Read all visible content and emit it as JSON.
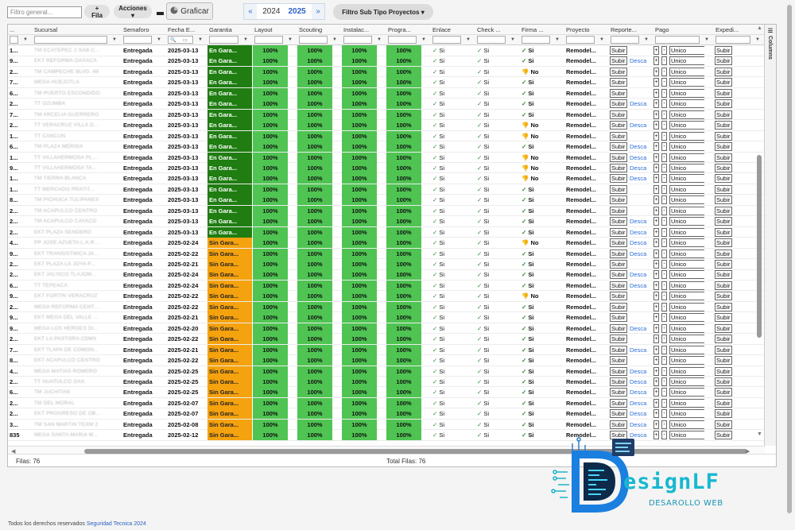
{
  "toolbar": {
    "filter_placeholder": "Filtro general...",
    "add_row_label": "+ Fila",
    "actions_label": "Acciones ▾",
    "chart_label": "Graficar",
    "years": [
      "2024",
      "2025"
    ],
    "active_year": "2025",
    "prev_label": "«",
    "next_label": "»",
    "subtype_label": "Filtro Sub Tipo Proyectos ▾"
  },
  "colors": {
    "garantia_en": "#1f7d12",
    "garantia_sin": "#f5a20f",
    "progress": "#4fc452",
    "accent": "#2b5fc4"
  },
  "columns": [
    "...",
    "Sucursal",
    "Semaforo",
    "Fecha E...",
    "Garantia",
    "Layout",
    "Scouting",
    "Instalac...",
    "Progra...",
    "Enlace",
    "Check ...",
    "Firma ...",
    "Proyecto",
    "Reporte...",
    "Pago",
    "Expedi..."
  ],
  "side_panel_label": "Columns",
  "rows": [
    {
      "id": "1...",
      "suc": "TM ECATEPEC 2 SAB C...",
      "sem": "Entregada",
      "fecha": "2025-03-13",
      "gar": "En Gara...",
      "gtype": "en",
      "firma": "Si",
      "desca": false
    },
    {
      "id": "9...",
      "suc": "EKT REFORMA OAXACA",
      "sem": "Entregada",
      "fecha": "2025-03-13",
      "gar": "En Gara...",
      "gtype": "en",
      "firma": "Si",
      "desca": true
    },
    {
      "id": "2...",
      "suc": "TM CAMPECHE BLVD. 49",
      "sem": "Entregada",
      "fecha": "2025-03-13",
      "gar": "En Gara...",
      "gtype": "en",
      "firma": "No",
      "desca": false
    },
    {
      "id": "7...",
      "suc": "MEGA HUEJUTLA",
      "sem": "Entregada",
      "fecha": "2025-03-13",
      "gar": "En Gara...",
      "gtype": "en",
      "firma": "Si",
      "desca": false
    },
    {
      "id": "6...",
      "suc": "TM PUERTO ESCONDIDO",
      "sem": "Entregada",
      "fecha": "2025-03-13",
      "gar": "En Gara...",
      "gtype": "en",
      "firma": "Si",
      "desca": false
    },
    {
      "id": "2...",
      "suc": "TT OZUMBA",
      "sem": "Entregada",
      "fecha": "2025-03-13",
      "gar": "En Gara...",
      "gtype": "en",
      "firma": "Si",
      "desca": true
    },
    {
      "id": "7...",
      "suc": "TM ARCELIA GUERRERO",
      "sem": "Entregada",
      "fecha": "2025-03-13",
      "gar": "En Gara...",
      "gtype": "en",
      "firma": "Si",
      "desca": false
    },
    {
      "id": "2...",
      "suc": "TT VERACRUZ VILLA D...",
      "sem": "Entregada",
      "fecha": "2025-03-13",
      "gar": "En Gara...",
      "gtype": "en",
      "firma": "No",
      "desca": true
    },
    {
      "id": "1...",
      "suc": "TT CANCUN",
      "sem": "Entregada",
      "fecha": "2025-03-13",
      "gar": "En Gara...",
      "gtype": "en",
      "firma": "No",
      "desca": false
    },
    {
      "id": "6...",
      "suc": "TM PLAZA MERIDA",
      "sem": "Entregada",
      "fecha": "2025-03-13",
      "gar": "En Gara...",
      "gtype": "en",
      "firma": "Si",
      "desca": true
    },
    {
      "id": "1...",
      "suc": "TT VILLAHERMOSA PL...",
      "sem": "Entregada",
      "fecha": "2025-03-13",
      "gar": "En Gara...",
      "gtype": "en",
      "firma": "No",
      "desca": true
    },
    {
      "id": "9...",
      "suc": "TT VILLAHERMOSA TA...",
      "sem": "Entregada",
      "fecha": "2025-03-13",
      "gar": "En Gara...",
      "gtype": "en",
      "firma": "No",
      "desca": true
    },
    {
      "id": "1...",
      "suc": "TM TIERRA BLANCA",
      "sem": "Entregada",
      "fecha": "2025-03-13",
      "gar": "En Gara...",
      "gtype": "en",
      "firma": "No",
      "desca": true
    },
    {
      "id": "1...",
      "suc": "TT MERCADO PRATIT...",
      "sem": "Entregada",
      "fecha": "2025-03-13",
      "gar": "En Gara...",
      "gtype": "en",
      "firma": "Si",
      "desca": false
    },
    {
      "id": "8...",
      "suc": "TM PICHUCA TULIPANES",
      "sem": "Entregada",
      "fecha": "2025-03-13",
      "gar": "En Gara...",
      "gtype": "en",
      "firma": "Si",
      "desca": false
    },
    {
      "id": "2...",
      "suc": "TM ACAPULCO CENTRO",
      "sem": "Entregada",
      "fecha": "2025-03-13",
      "gar": "En Gara...",
      "gtype": "en",
      "firma": "Si",
      "desca": false
    },
    {
      "id": "2...",
      "suc": "TM ACAPULCO CAYACO",
      "sem": "Entregada",
      "fecha": "2025-03-13",
      "gar": "En Gara...",
      "gtype": "en",
      "firma": "Si",
      "desca": true
    },
    {
      "id": "2...",
      "suc": "EKT PLAZA SENDERO",
      "sem": "Entregada",
      "fecha": "2025-03-13",
      "gar": "En Gara...",
      "gtype": "en",
      "firma": "Si",
      "desca": true
    },
    {
      "id": "4...",
      "suc": "PP JOSE AZUETA L.A.R...",
      "sem": "Entregada",
      "fecha": "2025-02-24",
      "gar": "Sin Gara...",
      "gtype": "sin",
      "firma": "No",
      "desca": true
    },
    {
      "id": "9...",
      "suc": "EKT TRANSISTMICA JA...",
      "sem": "Entregada",
      "fecha": "2025-02-22",
      "gar": "Sin Gara...",
      "gtype": "sin",
      "firma": "Si",
      "desca": true
    },
    {
      "id": "2...",
      "suc": "EKT PLAZA LA JOYA P...",
      "sem": "Entregada",
      "fecha": "2025-02-21",
      "gar": "Sin Gara...",
      "gtype": "sin",
      "firma": "Si",
      "desca": false
    },
    {
      "id": "2...",
      "suc": "EKT JALISCO TLAJOM...",
      "sem": "Entregada",
      "fecha": "2025-02-24",
      "gar": "Sin Gara...",
      "gtype": "sin",
      "firma": "Si",
      "desca": true
    },
    {
      "id": "6...",
      "suc": "TT TEPEACA",
      "sem": "Entregada",
      "fecha": "2025-02-24",
      "gar": "Sin Gara...",
      "gtype": "sin",
      "firma": "Si",
      "desca": true
    },
    {
      "id": "9...",
      "suc": "EKT FORTIN VERACRUZ",
      "sem": "Entregada",
      "fecha": "2025-02-22",
      "gar": "Sin Gara...",
      "gtype": "sin",
      "firma": "No",
      "desca": false
    },
    {
      "id": "2...",
      "suc": "MEGA REFORMA CENT...",
      "sem": "Entregada",
      "fecha": "2025-02-22",
      "gar": "Sin Gara...",
      "gtype": "sin",
      "firma": "Si",
      "desca": false
    },
    {
      "id": "9...",
      "suc": "EKT MEGA DEL VALLE ...",
      "sem": "Entregada",
      "fecha": "2025-02-21",
      "gar": "Sin Gara...",
      "gtype": "sin",
      "firma": "Si",
      "desca": false
    },
    {
      "id": "9...",
      "suc": "MEGA LOS HEROES DI...",
      "sem": "Entregada",
      "fecha": "2025-02-20",
      "gar": "Sin Gara...",
      "gtype": "sin",
      "firma": "Si",
      "desca": true
    },
    {
      "id": "2...",
      "suc": "EKT LA PASTORA CDMX",
      "sem": "Entregada",
      "fecha": "2025-02-22",
      "gar": "Sin Gara...",
      "gtype": "sin",
      "firma": "Si",
      "desca": false
    },
    {
      "id": "7...",
      "suc": "EKT TLAPA DE COMON...",
      "sem": "Entregada",
      "fecha": "2025-02-21",
      "gar": "Sin Gara...",
      "gtype": "sin",
      "firma": "Si",
      "desca": true
    },
    {
      "id": "8...",
      "suc": "EKT ACAPULCO CENTRO",
      "sem": "Entregada",
      "fecha": "2025-02-22",
      "gar": "Sin Gara...",
      "gtype": "sin",
      "firma": "Si",
      "desca": false
    },
    {
      "id": "4...",
      "suc": "MEGA MATIAS ROMERO",
      "sem": "Entregada",
      "fecha": "2025-02-25",
      "gar": "Sin Gara...",
      "gtype": "sin",
      "firma": "Si",
      "desca": true
    },
    {
      "id": "2...",
      "suc": "TT HUATULCO OAX.",
      "sem": "Entregada",
      "fecha": "2025-02-25",
      "gar": "Sin Gara...",
      "gtype": "sin",
      "firma": "Si",
      "desca": true
    },
    {
      "id": "6...",
      "suc": "TM JUCHITAN",
      "sem": "Entregada",
      "fecha": "2025-02-25",
      "gar": "Sin Gara...",
      "gtype": "sin",
      "firma": "Si",
      "desca": true
    },
    {
      "id": "2...",
      "suc": "TM DEL MORAL",
      "sem": "Entregada",
      "fecha": "2025-02-07",
      "gar": "Sin Gara...",
      "gtype": "sin",
      "firma": "Si",
      "desca": true
    },
    {
      "id": "2...",
      "suc": "EKT PROGRESO DE OB...",
      "sem": "Entregada",
      "fecha": "2025-02-07",
      "gar": "Sin Gara...",
      "gtype": "sin",
      "firma": "Si",
      "desca": true
    },
    {
      "id": "3...",
      "suc": "TM SAN MARTIN TEXM 2",
      "sem": "Entregada",
      "fecha": "2025-02-08",
      "gar": "Sin Gara...",
      "gtype": "sin",
      "firma": "Si",
      "desca": true
    },
    {
      "id": "835",
      "suc": "MEGA SANTA MARIA M...",
      "sem": "Entregada",
      "fecha": "2025-02-12",
      "gar": "Sin Gara...",
      "gtype": "sin",
      "firma": "Si",
      "desca": true
    }
  ],
  "cell_text": {
    "pct": "100%",
    "enlace": "Si",
    "check": "Si",
    "proyecto": "Remodel...",
    "subir": "Subir",
    "desca": "Desca",
    "plus": "+",
    "minus": "-",
    "pago": "Unico",
    "yes_glyph": "✓",
    "no_glyph": "👎"
  },
  "footer": {
    "filas": "Filas: 76",
    "total": "Total Filas: 76"
  },
  "copyright": {
    "text": "Todos los derechos reservados",
    "link": "Seguridad Tecnica 2024"
  },
  "logo": {
    "title": "esignLF",
    "letter": "D",
    "subtitle": "DESAROLLO WEB"
  }
}
